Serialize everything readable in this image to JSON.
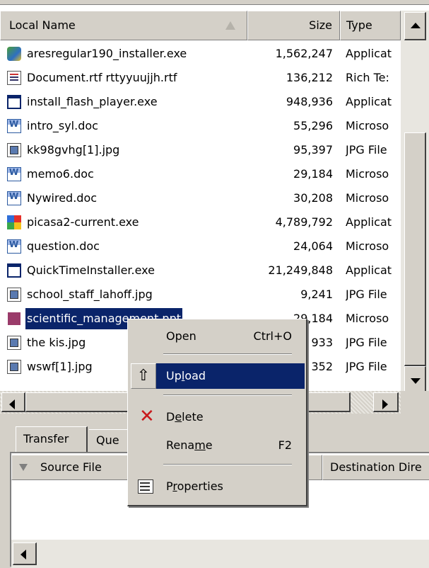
{
  "file_list": {
    "columns": {
      "name": "Local Name",
      "size": "Size",
      "type": "Type"
    },
    "files": [
      {
        "name": "aresregular190_installer.exe",
        "size": "1,562,247",
        "type": "Applicat",
        "icon": "ares-icon"
      },
      {
        "name": "Document.rtf rttyyuujjh.rtf",
        "size": "136,212",
        "type": "Rich Te:",
        "icon": "rtf-icon"
      },
      {
        "name": "install_flash_player.exe",
        "size": "948,936",
        "type": "Applicat",
        "icon": "exe-icon"
      },
      {
        "name": "intro_syl.doc",
        "size": "55,296",
        "type": "Microso",
        "icon": "word-doc-icon"
      },
      {
        "name": "kk98gvhg[1].jpg",
        "size": "95,397",
        "type": "JPG File",
        "icon": "jpg-icon"
      },
      {
        "name": "memo6.doc",
        "size": "29,184",
        "type": "Microso",
        "icon": "word-doc-icon"
      },
      {
        "name": "Nywired.doc",
        "size": "30,208",
        "type": "Microso",
        "icon": "word-doc-icon"
      },
      {
        "name": "picasa2-current.exe",
        "size": "4,789,792",
        "type": "Applicat",
        "icon": "picasa-icon"
      },
      {
        "name": "question.doc",
        "size": "24,064",
        "type": "Microso",
        "icon": "word-doc-icon"
      },
      {
        "name": "QuickTimeInstaller.exe",
        "size": "21,249,848",
        "type": "Applicat",
        "icon": "exe-icon"
      },
      {
        "name": "school_staff_lahoff.jpg",
        "size": "9,241",
        "type": "JPG File",
        "icon": "jpg-icon"
      },
      {
        "name": "scientific_management.ppt",
        "size": "29,184",
        "type": "Microso",
        "icon": "ppt-icon"
      },
      {
        "name": "the kis.jpg",
        "size": "933",
        "type": "JPG File",
        "icon": "jpg-icon"
      },
      {
        "name": "wswf[1].jpg",
        "size": "352",
        "type": "JPG File",
        "icon": "jpg-icon"
      }
    ],
    "selected_file": "scientific_management.ppt"
  },
  "context_menu": {
    "open": {
      "label": "Open",
      "shortcut": "Ctrl+O"
    },
    "upload": {
      "label_pre": "Up",
      "label_mnemonic": "l",
      "label_post": "oad",
      "icon": "upload-arrow-icon",
      "highlighted": true
    },
    "delete": {
      "label_pre": "D",
      "label_mnemonic": "e",
      "label_post": "lete",
      "icon": "red-x-delete-icon"
    },
    "rename": {
      "label_pre": "Rena",
      "label_mnemonic": "m",
      "label_post": "e",
      "shortcut": "F2"
    },
    "properties": {
      "label_pre": "P",
      "label_mnemonic": "r",
      "label_post": "operties",
      "icon": "properties-icon"
    }
  },
  "transfer_pane": {
    "tabs": {
      "transfer": "Transfer",
      "queue": "Que"
    },
    "columns": {
      "source": "Source File",
      "destination": "Destination Dire"
    }
  },
  "colors": {
    "selection": "#0a246a",
    "face": "#d4d0c8",
    "delete_icon": "#c8191c"
  }
}
